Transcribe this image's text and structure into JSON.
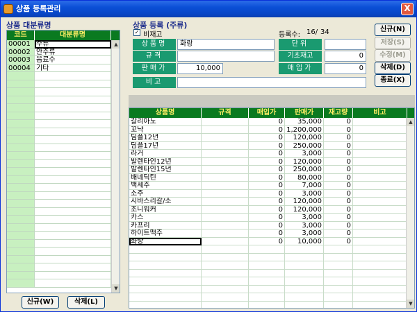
{
  "window": {
    "title": "상품 등록관리",
    "close_label": "X"
  },
  "category": {
    "section_title": "상품 대분류명",
    "columns": [
      "코드",
      "대분류명"
    ],
    "rows": [
      {
        "code": "00001",
        "name": "주류"
      },
      {
        "code": "00002",
        "name": "안주류"
      },
      {
        "code": "00003",
        "name": "음료수"
      },
      {
        "code": "00004",
        "name": "기타"
      }
    ],
    "new_button": "신규(W)",
    "delete_button": "삭제(L)"
  },
  "form": {
    "section_title": "상품 등록 (주류)",
    "no_stock_checkbox": "비재고",
    "no_stock_checked": true,
    "count_label": "등록수:",
    "count_value": "16/",
    "count_total": "34",
    "labels": {
      "name": "상품명",
      "spec": "규격",
      "price": "판매가",
      "note": "비고",
      "unit": "단위",
      "init_stock": "기초재고",
      "buy_price": "매입가"
    },
    "values": {
      "name": "화랑",
      "spec": "",
      "price": "10,000",
      "note": "",
      "unit": "",
      "init_stock": "0",
      "buy_price": "0"
    }
  },
  "actions": {
    "new": "신규(N)",
    "save": "저장(S)",
    "modify": "수정(M)",
    "delete": "삭제(D)",
    "exit": "종료(X)"
  },
  "products": {
    "columns": [
      "상품명",
      "규격",
      "매입가",
      "판매가",
      "재고량",
      "비고"
    ],
    "rows": [
      {
        "name": "갈리아노",
        "spec": "",
        "buy": "0",
        "sell": "35,000",
        "stock": "0",
        "note": ""
      },
      {
        "name": "꼬냑",
        "spec": "",
        "buy": "0",
        "sell": "1,200,000",
        "stock": "0",
        "note": ""
      },
      {
        "name": "딤플12년",
        "spec": "",
        "buy": "0",
        "sell": "120,000",
        "stock": "0",
        "note": ""
      },
      {
        "name": "딤플17년",
        "spec": "",
        "buy": "0",
        "sell": "250,000",
        "stock": "0",
        "note": ""
      },
      {
        "name": "라거",
        "spec": "",
        "buy": "0",
        "sell": "3,000",
        "stock": "0",
        "note": ""
      },
      {
        "name": "발렌타인12년",
        "spec": "",
        "buy": "0",
        "sell": "120,000",
        "stock": "0",
        "note": ""
      },
      {
        "name": "발렌타인15년",
        "spec": "",
        "buy": "0",
        "sell": "250,000",
        "stock": "0",
        "note": ""
      },
      {
        "name": "배네딕틴",
        "spec": "",
        "buy": "0",
        "sell": "80,000",
        "stock": "0",
        "note": ""
      },
      {
        "name": "백세주",
        "spec": "",
        "buy": "0",
        "sell": "7,000",
        "stock": "0",
        "note": ""
      },
      {
        "name": "소주",
        "spec": "",
        "buy": "0",
        "sell": "3,000",
        "stock": "0",
        "note": ""
      },
      {
        "name": "시바스리갈/소",
        "spec": "",
        "buy": "0",
        "sell": "120,000",
        "stock": "0",
        "note": ""
      },
      {
        "name": "조니워커",
        "spec": "",
        "buy": "0",
        "sell": "120,000",
        "stock": "0",
        "note": ""
      },
      {
        "name": "카스",
        "spec": "",
        "buy": "0",
        "sell": "3,000",
        "stock": "0",
        "note": ""
      },
      {
        "name": "카프리",
        "spec": "",
        "buy": "0",
        "sell": "3,000",
        "stock": "0",
        "note": ""
      },
      {
        "name": "하이트맥주",
        "spec": "",
        "buy": "0",
        "sell": "3,000",
        "stock": "0",
        "note": ""
      },
      {
        "name": "화랑",
        "spec": "",
        "buy": "0",
        "sell": "10,000",
        "stock": "0",
        "note": ""
      }
    ]
  },
  "colors": {
    "header_bg": "#0a7a20",
    "header_text": "#ffee66",
    "label_bg": "#1a9a70",
    "code_col_bg": "#c8f0c0",
    "title_bar": "#0a4fd6"
  }
}
